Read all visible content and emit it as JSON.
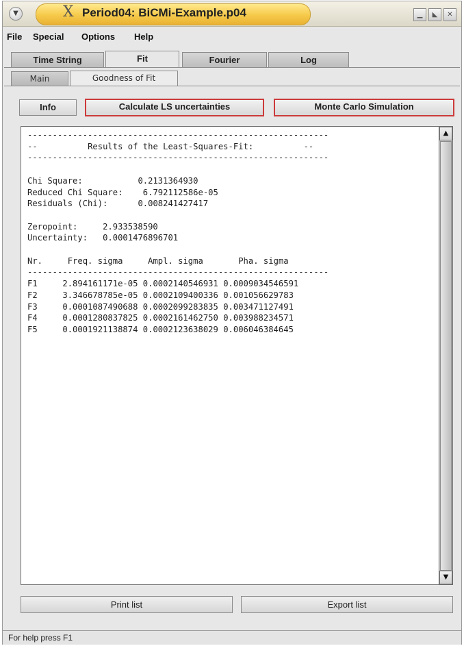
{
  "window": {
    "title": "Period04: BiCMi-Example.p04",
    "menu_icon": "chevron-down-icon",
    "logo_icon": "x-logo-icon",
    "minimize_icon": "minimize-icon",
    "maximize_icon": "maximize-icon",
    "close_icon": "close-icon"
  },
  "menu": [
    "File",
    "Special",
    "Options",
    "Help"
  ],
  "tabs": [
    "Time String",
    "Fit",
    "Fourier",
    "Log"
  ],
  "active_tab": "Fit",
  "subtabs": [
    "Main",
    "Goodness of Fit"
  ],
  "active_subtab": "Goodness of Fit",
  "buttons": {
    "info": "Info",
    "calc_ls": "Calculate LS uncertainties",
    "monte_carlo": "Monte Carlo Simulation",
    "print_list": "Print list",
    "export_list": "Export list"
  },
  "results": {
    "header_line": "------------------------------------------------------------",
    "header_title": "Results of the Least-Squares-Fit:",
    "header_dash": "--",
    "chi_square_label": "Chi Square:",
    "chi_square": "0.2131364930",
    "reduced_chi_label": "Reduced Chi Square:",
    "reduced_chi": "6.792112586e-05",
    "residuals_label": "Residuals (Chi):",
    "residuals": "0.008241427417",
    "zeropoint_label": "Zeropoint:",
    "zeropoint": "2.933538590",
    "uncertainty_label": "Uncertainty:",
    "uncertainty": "0.0001476896701",
    "columns": [
      "Nr.",
      "Freq. sigma",
      "Ampl. sigma",
      "Pha. sigma"
    ],
    "rows": [
      [
        "F1",
        "2.894161171e-05",
        "0.0002140546931",
        "0.0009034546591"
      ],
      [
        "F2",
        "3.346678785e-05",
        "0.0002109400336",
        "0.001056629783"
      ],
      [
        "F3",
        "0.0001087490688",
        "0.0002099283835",
        "0.003471127491"
      ],
      [
        "F4",
        "0.0001280837825",
        "0.0002161462750",
        "0.003988234571"
      ],
      [
        "F5",
        "0.0001921138874",
        "0.0002123638029",
        "0.006046384645"
      ]
    ]
  },
  "status": "For help press F1",
  "colors": {
    "title_accent": "#f6c94a",
    "button_border_red": "#cc3a3a"
  }
}
